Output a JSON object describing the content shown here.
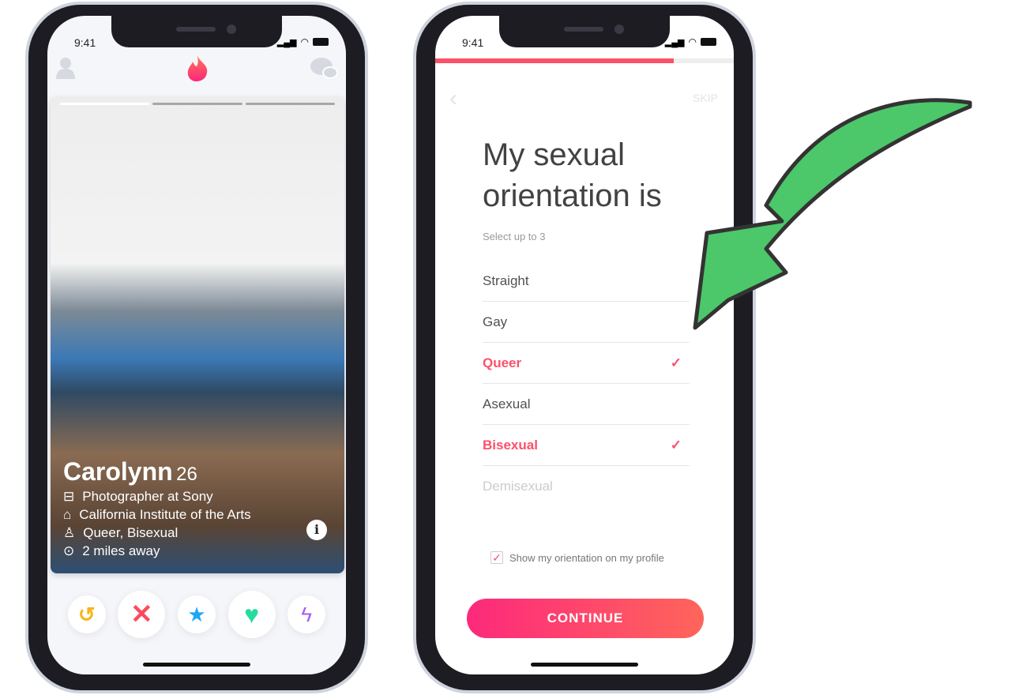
{
  "status": {
    "time": "9:41"
  },
  "profile": {
    "name": "Carolynn",
    "age": "26",
    "details": [
      {
        "icon": "briefcase-icon",
        "text": "Photographer at Sony"
      },
      {
        "icon": "graduation-cap-icon",
        "text": "California Institute of the Arts"
      },
      {
        "icon": "person-icon",
        "text": "Queer, Bisexual"
      },
      {
        "icon": "location-pin-icon",
        "text": "2 miles away"
      }
    ],
    "photo_count": 3,
    "current_photo": 1,
    "info_label": "i",
    "actions": [
      "rewind-icon",
      "nope-icon",
      "super-like-icon",
      "like-icon",
      "boost-icon"
    ]
  },
  "onboarding": {
    "progress": 0.8,
    "skip": "SKIP",
    "title_line1": "My sexual",
    "title_line2": "orientation is",
    "subtitle": "Select up to 3",
    "options": [
      {
        "label": "Straight",
        "selected": false
      },
      {
        "label": "Gay",
        "selected": false
      },
      {
        "label": "Queer",
        "selected": true
      },
      {
        "label": "Asexual",
        "selected": false
      },
      {
        "label": "Bisexual",
        "selected": true
      },
      {
        "label": "Demisexual",
        "selected": false
      }
    ],
    "show_orientation": "Show my orientation on my profile",
    "show_checked": true,
    "continue": "CONTINUE"
  },
  "colors": {
    "brand": "#fd5068",
    "arrow": "#4cc76a"
  }
}
